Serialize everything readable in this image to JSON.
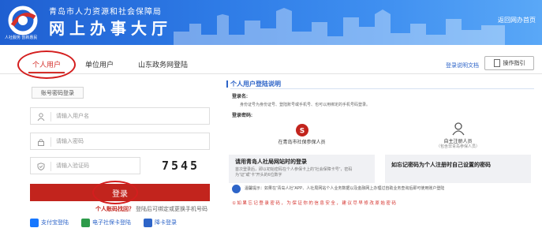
{
  "header": {
    "org_name": "青岛市人力资源和社会保障局",
    "site_title": "网上办事大厅",
    "logo_caption": "人社服务 创新惠民",
    "return_link": "返回网办首页"
  },
  "tabs": [
    {
      "label": "个人用户",
      "active": true
    },
    {
      "label": "单位用户",
      "active": false
    },
    {
      "label": "山东政务网登陆",
      "active": false
    }
  ],
  "top_right": {
    "doc_link": "登录说明文档",
    "guide_button": "操作指引"
  },
  "login": {
    "subtab_label": "账号密码登录",
    "username_placeholder": "请输入用户名",
    "password_placeholder": "请输入密码",
    "captcha_placeholder": "请输入验证码",
    "captcha_text": "7545",
    "login_button": "登录",
    "forgot_label": "个人账码找回？",
    "forgot_hint": "登陆后可绑定或更换手机号码",
    "alt_logins": [
      {
        "label": "支付宝登陆",
        "icon": "alipay-icon",
        "color": "#1677ff"
      },
      {
        "label": "电子社保卡登陆",
        "icon": "social-card-icon",
        "color": "#2d9b4a"
      },
      {
        "label": "降卡登录",
        "icon": "card-login-icon",
        "color": "#2d64c8"
      }
    ]
  },
  "info": {
    "title": "个人用户登陆说明",
    "login_name_label": "登录名:",
    "login_name_desc": "身份证号为身份证号、登陆账号或手机号、也可以用绑定的手机号码登录。",
    "password_label": "登录密码:",
    "cards": [
      {
        "icon": "social-security-logo-icon",
        "caption": "在青岛市社保参保人员",
        "subcaption": "",
        "desc_title": "请用青岛人社局网站时的登录",
        "desc": "首次登录后，即以初始密码在个人参保卡上的“社会保障卡号”，密码为“证”或“卡”开头的6位数字"
      },
      {
        "icon": "person-icon",
        "caption": "自主注册人员",
        "subcaption": "（包含非青岛参保人员）",
        "desc_title": "如忘记密码为个人注册时自己设置的密码",
        "desc": ""
      }
    ],
    "notice": "温馨提示：如果在“青岛人社”APP、人社局网站个人业务数据以及金融网上办理过自助业务查询后即可使用账户登陆",
    "warning": "①如果忘记登录密码，为保证你的信息安全，建议尽早修改原始密码"
  },
  "colors": {
    "brand_blue": "#2d64c8",
    "accent_red": "#c2241d",
    "annotation_red": "#d41e1e"
  }
}
